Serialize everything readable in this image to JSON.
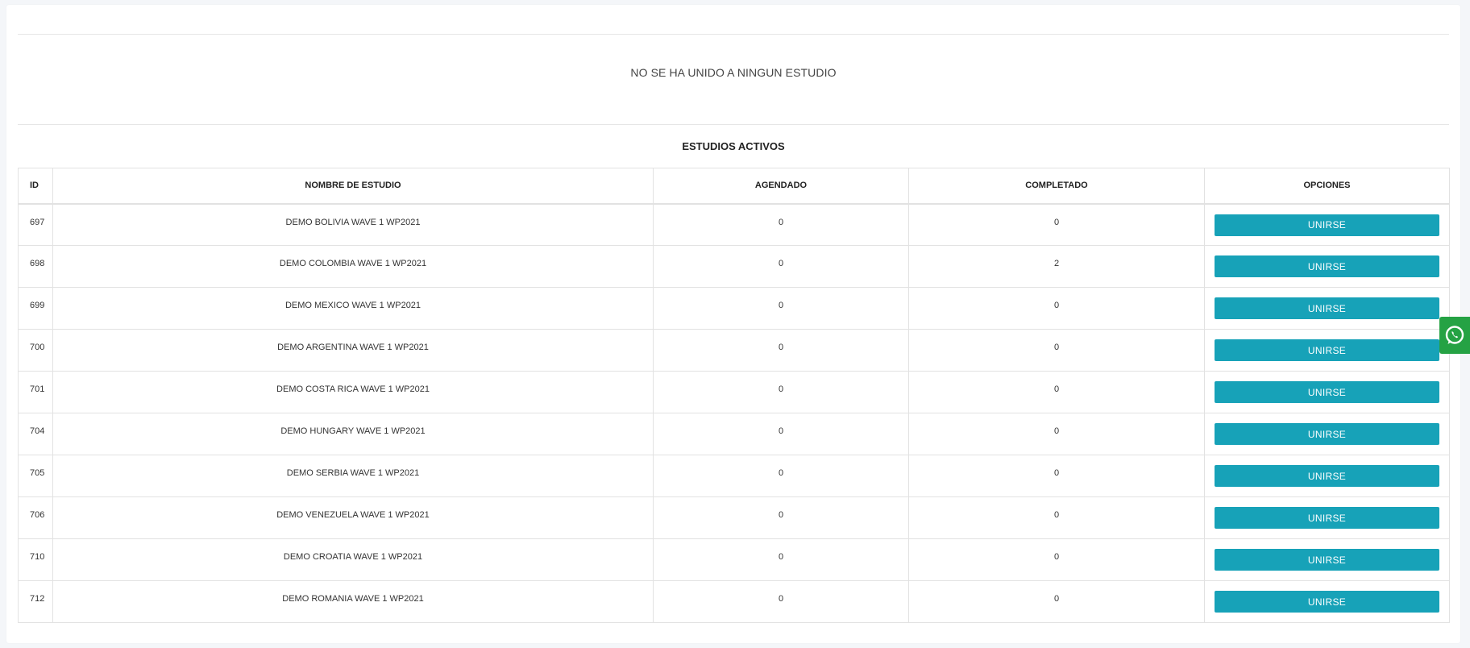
{
  "notice": {
    "empty_message": "NO SE HA UNIDO A NINGUN ESTUDIO"
  },
  "active_studies": {
    "title": "ESTUDIOS ACTIVOS",
    "columns": {
      "id": "ID",
      "name": "NOMBRE DE ESTUDIO",
      "scheduled": "AGENDADO",
      "completed": "COMPLETADO",
      "options": "OPCIONES"
    },
    "rows": [
      {
        "id": "697",
        "name": "DEMO BOLIVIA WAVE 1 WP2021",
        "scheduled": "0",
        "completed": "0",
        "action": "UNIRSE"
      },
      {
        "id": "698",
        "name": "DEMO COLOMBIA WAVE 1 WP2021",
        "scheduled": "0",
        "completed": "2",
        "action": "UNIRSE"
      },
      {
        "id": "699",
        "name": "DEMO MEXICO WAVE 1 WP2021",
        "scheduled": "0",
        "completed": "0",
        "action": "UNIRSE"
      },
      {
        "id": "700",
        "name": "DEMO ARGENTINA WAVE 1 WP2021",
        "scheduled": "0",
        "completed": "0",
        "action": "UNIRSE"
      },
      {
        "id": "701",
        "name": "DEMO COSTA RICA WAVE 1 WP2021",
        "scheduled": "0",
        "completed": "0",
        "action": "UNIRSE"
      },
      {
        "id": "704",
        "name": "DEMO HUNGARY WAVE 1 WP2021",
        "scheduled": "0",
        "completed": "0",
        "action": "UNIRSE"
      },
      {
        "id": "705",
        "name": "DEMO SERBIA WAVE 1 WP2021",
        "scheduled": "0",
        "completed": "0",
        "action": "UNIRSE"
      },
      {
        "id": "706",
        "name": "DEMO VENEZUELA WAVE 1 WP2021",
        "scheduled": "0",
        "completed": "0",
        "action": "UNIRSE"
      },
      {
        "id": "710",
        "name": "DEMO CROATIA WAVE 1 WP2021",
        "scheduled": "0",
        "completed": "0",
        "action": "UNIRSE"
      },
      {
        "id": "712",
        "name": "DEMO ROMANIA WAVE 1 WP2021",
        "scheduled": "0",
        "completed": "0",
        "action": "UNIRSE"
      }
    ]
  },
  "theme": {
    "button_color": "#17a2b8",
    "whatsapp_color": "#25a244"
  },
  "icons": {
    "floating_contact": "whatsapp-icon"
  }
}
